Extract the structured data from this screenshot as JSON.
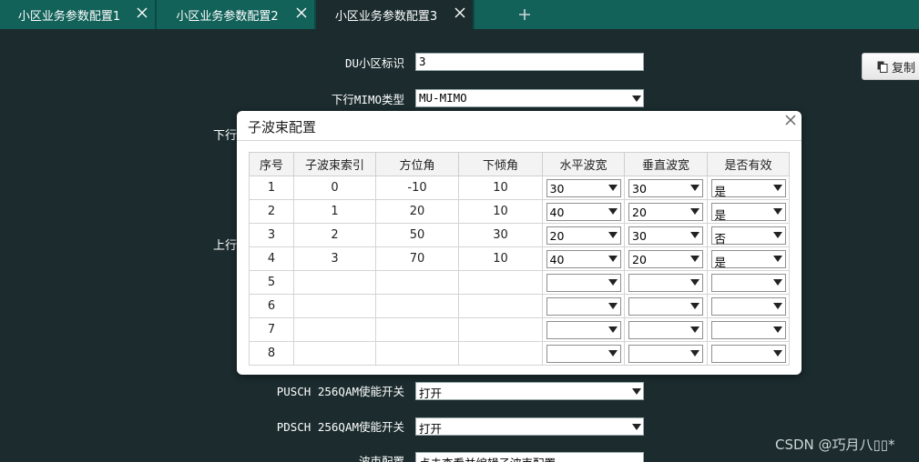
{
  "tabs": [
    {
      "label": "小区业务参数配置1",
      "active": false
    },
    {
      "label": "小区业务参数配置2",
      "active": false
    },
    {
      "label": "小区业务参数配置3",
      "active": true
    }
  ],
  "form": {
    "du_cell_id_label": "DU小区标识",
    "du_cell_id_value": "3",
    "dl_mimo_type_label": "下行MIMO类型",
    "dl_mimo_type_value": "MU-MIMO",
    "dl_partial_label": "下行",
    "ul_partial_label": "上行",
    "pusch_256qam_label": "PUSCH 256QAM使能开关",
    "pusch_256qam_value": "打开",
    "pdsch_256qam_label": "PDSCH 256QAM使能开关",
    "pdsch_256qam_value": "打开",
    "beam_config_label": "波束配置",
    "beam_config_value": "点击查看并编辑子波束配置"
  },
  "toolbar": {
    "copy_label": "复制"
  },
  "dialog": {
    "title": "子波束配置",
    "columns": [
      "序号",
      "子波束索引",
      "方位角",
      "下倾角",
      "水平波宽",
      "垂直波宽",
      "是否有效"
    ],
    "rows": [
      {
        "no": "1",
        "index": "0",
        "azimuth": "-10",
        "tilt": "10",
        "h_width": "30",
        "v_width": "30",
        "valid": "是"
      },
      {
        "no": "2",
        "index": "1",
        "azimuth": "20",
        "tilt": "10",
        "h_width": "40",
        "v_width": "20",
        "valid": "是"
      },
      {
        "no": "3",
        "index": "2",
        "azimuth": "50",
        "tilt": "30",
        "h_width": "20",
        "v_width": "30",
        "valid": "否"
      },
      {
        "no": "4",
        "index": "3",
        "azimuth": "70",
        "tilt": "10",
        "h_width": "40",
        "v_width": "20",
        "valid": "是"
      },
      {
        "no": "5",
        "index": "",
        "azimuth": "",
        "tilt": "",
        "h_width": "",
        "v_width": "",
        "valid": ""
      },
      {
        "no": "6",
        "index": "",
        "azimuth": "",
        "tilt": "",
        "h_width": "",
        "v_width": "",
        "valid": ""
      },
      {
        "no": "7",
        "index": "",
        "azimuth": "",
        "tilt": "",
        "h_width": "",
        "v_width": "",
        "valid": ""
      },
      {
        "no": "8",
        "index": "",
        "azimuth": "",
        "tilt": "",
        "h_width": "",
        "v_width": "",
        "valid": ""
      }
    ]
  },
  "watermark": "CSDN @巧月八▯▯*",
  "colors": {
    "tab_bar": "#12625a",
    "background": "#1b2b2e",
    "dialog_bg": "#ffffff"
  },
  "icons": {
    "tab_close": "close-icon",
    "tab_add": "plus-icon",
    "dialog_close": "close-icon",
    "copy": "copy-icon",
    "dropdown": "chevron-down-icon"
  }
}
